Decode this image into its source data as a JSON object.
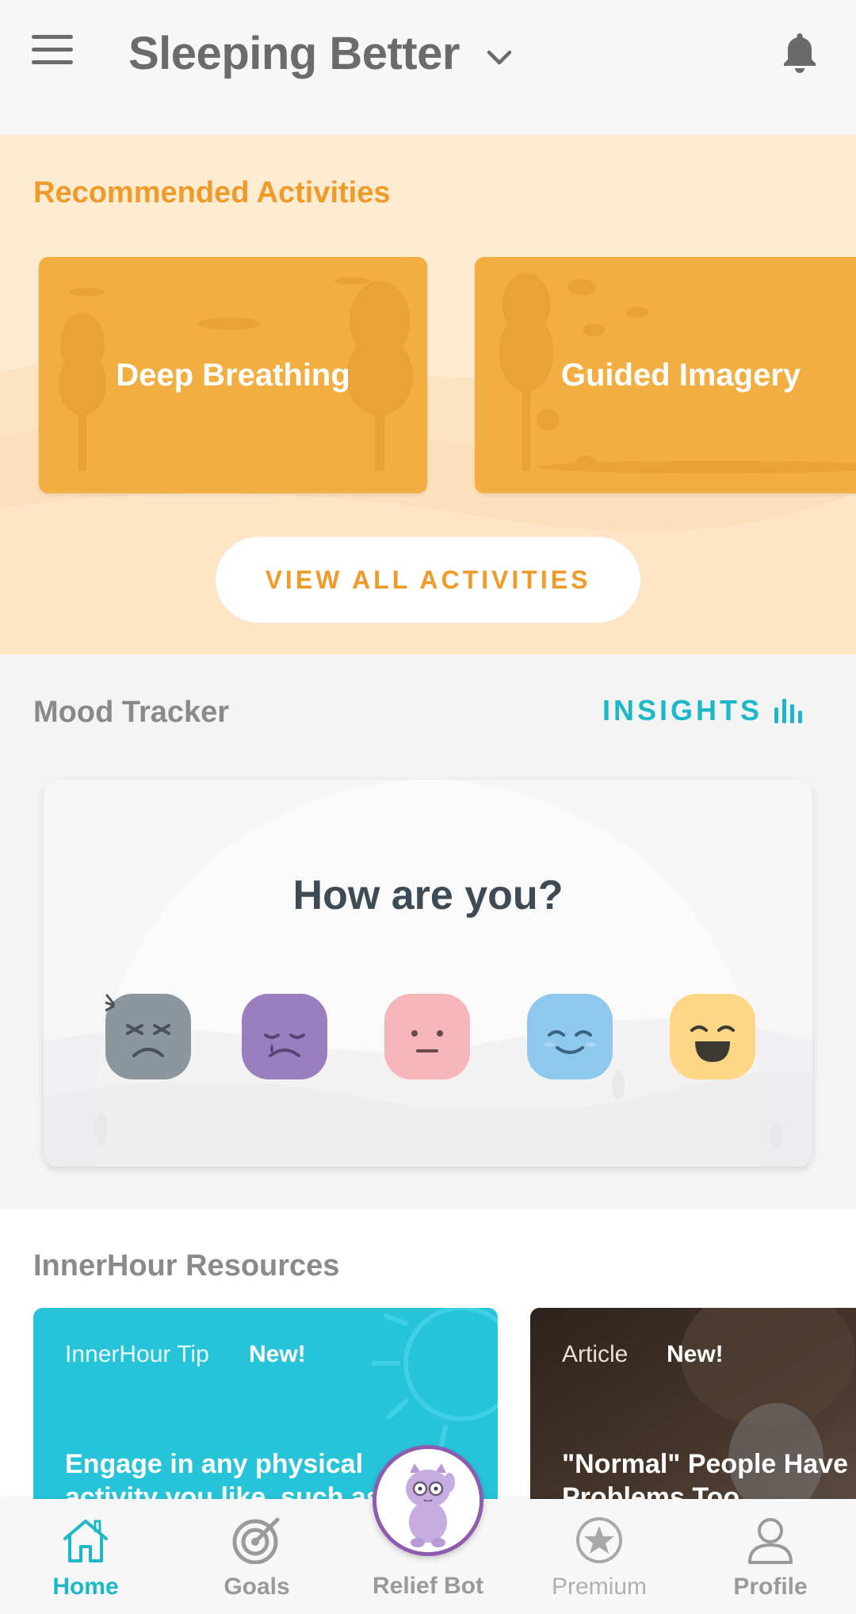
{
  "header": {
    "title": "Sleeping Better",
    "menu_icon": "hamburger-menu-icon",
    "dropdown_icon": "chevron-down-icon",
    "notification_icon": "bell-icon"
  },
  "recommended": {
    "title": "Recommended Activities",
    "cards": [
      {
        "label": "Deep Breathing"
      },
      {
        "label": "Guided Imagery"
      }
    ],
    "view_all_label": "VIEW ALL ACTIVITIES",
    "accent_color": "#f09a2a"
  },
  "mood": {
    "title": "Mood Tracker",
    "insights_label": "INSIGHTS",
    "insights_icon": "bar-chart-icon",
    "question": "How are you?",
    "faces": [
      {
        "name": "angry-face-icon",
        "color": "#8d969e"
      },
      {
        "name": "sad-face-icon",
        "color": "#9a7fc0"
      },
      {
        "name": "neutral-face-icon",
        "color": "#f6b5b8"
      },
      {
        "name": "content-face-icon",
        "color": "#8ec8ee"
      },
      {
        "name": "happy-face-icon",
        "color": "#fdd786"
      }
    ]
  },
  "resources": {
    "title": "InnerHour Resources",
    "cards": [
      {
        "tag": "InnerHour Tip",
        "new": "New!",
        "text_line1": "Engage in any physical",
        "text_line2": "activity you like, such as r..."
      },
      {
        "tag": "Article",
        "new": "New!",
        "text_line1": "\"Normal\" People Have",
        "text_line2": "Problems Too"
      }
    ]
  },
  "nav": {
    "items": [
      {
        "label": "Home",
        "icon": "home-icon"
      },
      {
        "label": "Goals",
        "icon": "target-icon"
      },
      {
        "label": "Relief Bot",
        "icon": "relief-bot-mascot-icon"
      },
      {
        "label": "Premium",
        "icon": "star-icon"
      },
      {
        "label": "Profile",
        "icon": "user-icon"
      }
    ],
    "active_color": "#1cb8c8"
  }
}
